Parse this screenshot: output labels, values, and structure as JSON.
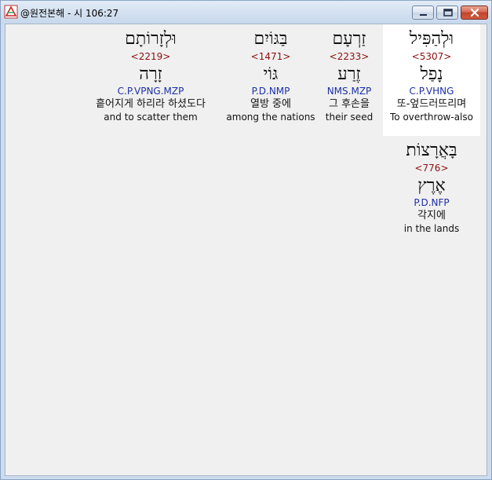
{
  "window": {
    "title": "@원전본해 - 시 106:27",
    "buttons": {
      "minimize": "",
      "maximize": "",
      "close": ""
    }
  },
  "words": [
    {
      "hebrew": "וּלְהַפִּיל",
      "strong": "<5307>",
      "root": "נָפַל",
      "morph": "C.P.VHNG",
      "korean": "또-엎드러뜨리며",
      "english": "To overthrow-also",
      "selected": true
    },
    {
      "hebrew": "זַרְעָם",
      "strong": "<2233>",
      "root": "זֶרַע",
      "morph": "NMS.MZP",
      "korean": "그 후손을",
      "english": "their seed",
      "selected": false
    },
    {
      "hebrew": "בַּגּוֹיִם",
      "strong": "<1471>",
      "root": "גּוֹי",
      "morph": "P.D.NMP",
      "korean": "열방 중에",
      "english": "among the nations",
      "selected": false
    },
    {
      "hebrew": "וּלְזָרוֹתָם",
      "strong": "<2219>",
      "root": "זָרָה",
      "morph": "C.P.VPNG.MZP",
      "korean": "흩어지게 하리라 하셨도다",
      "english": "and to scatter them",
      "selected": false
    },
    {
      "hebrew": "בָּאֲרָצוֹת׃",
      "strong": "<776>",
      "root": "אֶרֶץ",
      "morph": "P.D.NFP",
      "korean": "각지에",
      "english": "in the lands",
      "selected": false
    }
  ]
}
